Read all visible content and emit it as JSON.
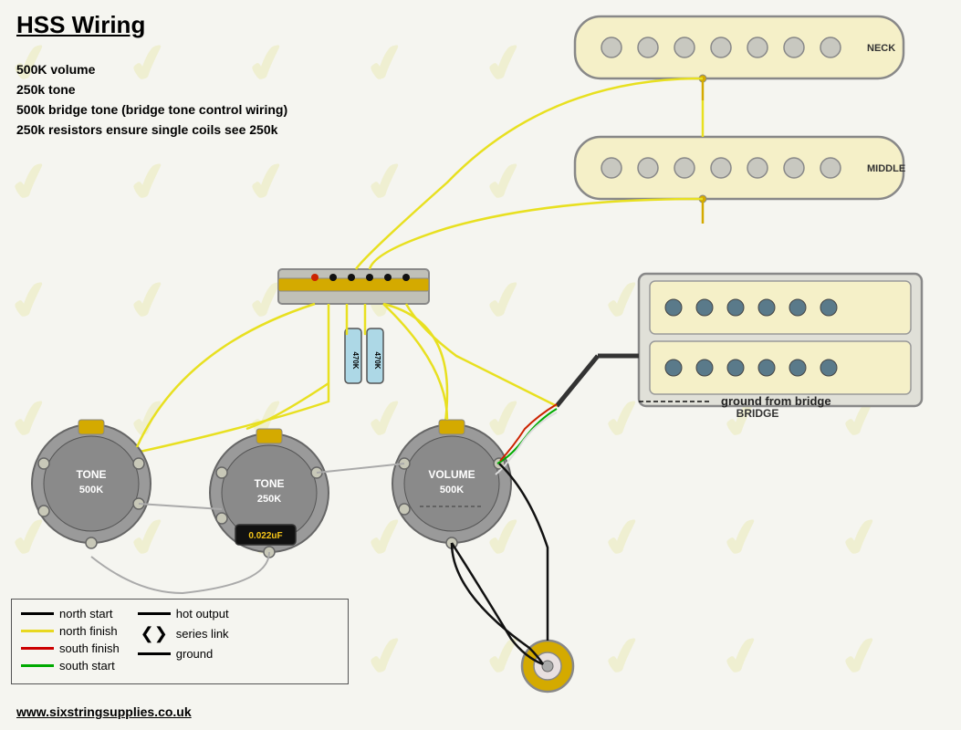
{
  "title": "HSS Wiring",
  "specs": [
    "500K volume",
    "250k tone",
    "500k bridge tone (bridge tone control wiring)",
    "250k resistors ensure single coils see 250k"
  ],
  "legend": {
    "items": [
      {
        "color": "#000000",
        "label": "north start",
        "type": "line"
      },
      {
        "color": "#f5c518",
        "label": "north finish",
        "type": "line"
      },
      {
        "color": "#cc0000",
        "label": "south finish",
        "type": "line"
      },
      {
        "color": "#00aa00",
        "label": "south start",
        "type": "line"
      },
      {
        "color": "#000000",
        "label": "hot output",
        "type": "line"
      },
      {
        "label": "series link",
        "type": "arrow"
      },
      {
        "color": "#000000",
        "label": "ground",
        "type": "line"
      }
    ]
  },
  "labels": {
    "neck": "NECK",
    "middle": "MIDDLE",
    "bridge": "BRIDGE",
    "tone500k": "TONE\n500K",
    "tone250k": "TONE\n250K",
    "volume": "VOLUME\n500K",
    "cap": "0.022uF",
    "res1": "470K",
    "res2": "470K",
    "groundBridge": "ground from bridge"
  },
  "website": "www.sixstringsupplies.co.uk"
}
